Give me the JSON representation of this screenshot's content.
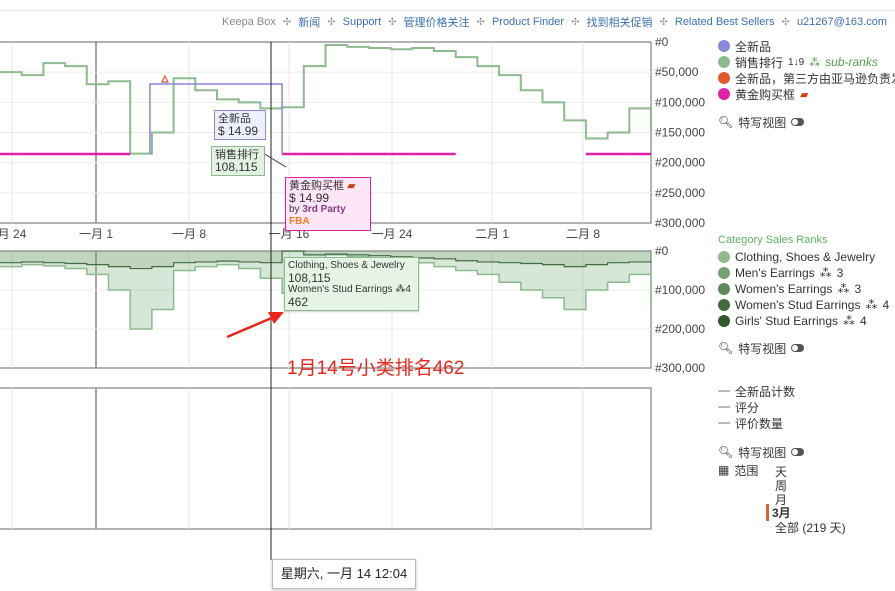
{
  "nav": {
    "items": [
      "Keepa Box",
      "新闻",
      "Support",
      "管理价格关注",
      "Product Finder",
      "找到相关促销",
      "Related Best Sellers",
      "u21267@163.com"
    ],
    "separator": "✣"
  },
  "legend_top": {
    "items": [
      {
        "label": "全新品",
        "color": "#8888dd"
      },
      {
        "label": "销售排行",
        "color": "#8dbb8d",
        "sort_icon": "1↓9",
        "sub_label": "sub-ranks"
      },
      {
        "label": "全新品，第三方由亚马逊负责发",
        "color": "#e05a2b"
      },
      {
        "label": "黄金购买框",
        "color": "#e020a8"
      }
    ],
    "close_view": "特写视图"
  },
  "legend_mid": {
    "title": "Category Sales Ranks",
    "items": [
      {
        "label": "Clothing, Shoes & Jewelry",
        "color": "#8dbb8d",
        "level": ""
      },
      {
        "label": "Men's Earrings",
        "color": "#74a374",
        "level": "3"
      },
      {
        "label": "Women's Earrings",
        "color": "#5a8a5a",
        "level": "3"
      },
      {
        "label": "Women's Stud Earrings",
        "color": "#3f6d3f",
        "level": "4"
      },
      {
        "label": "Girls' Stud Earrings",
        "color": "#2e5a2e",
        "level": "4"
      }
    ],
    "close_view": "特写视图"
  },
  "legend_bottom": {
    "items": [
      "全新品计数",
      "评分",
      "评价数量"
    ],
    "close_view": "特写视图",
    "range_label": "范围",
    "range_options": [
      "天",
      "周",
      "月",
      "3月",
      "全部 (219 天)"
    ],
    "range_selected": "3月"
  },
  "tooltips": {
    "new": {
      "title": "全新品",
      "value": "$ 14.99"
    },
    "rank": {
      "title": "销售排行",
      "value": "108,115"
    },
    "buybox": {
      "title": "黄金购买框",
      "value": "$ 14.99",
      "seller_prefix": "by",
      "seller": "3rd Party",
      "fba": "FBA"
    },
    "category": {
      "cat": "Clothing, Shoes & Jewelry",
      "cat_value": "108,115",
      "sub": "Women's Stud Earrings",
      "sub_level": "4",
      "sub_value": "462"
    }
  },
  "annotation": "1月14号小类排名462",
  "hover_date": "星期六, 一月 14 12:04",
  "chart_data": [
    {
      "type": "line",
      "x_ticks": [
        "月 24",
        "一月 1",
        "一月 8",
        "一月 16",
        "一月 24",
        "二月 1",
        "二月 8"
      ],
      "y_ticks": [
        "#0",
        "#50,000",
        "#100,000",
        "#150,000",
        "#200,000",
        "#250,000",
        "#300,000"
      ],
      "ylim": [
        0,
        300000
      ],
      "series": [
        {
          "name": "销售排行",
          "color": "#8dbb8d",
          "values": [
            50000,
            55000,
            35000,
            40000,
            70000,
            65000,
            185000,
            150000,
            60000,
            80000,
            95000,
            100000,
            110000,
            108115,
            40000,
            5000,
            8000,
            10000,
            12000,
            10000,
            15000,
            25000,
            40000,
            55000,
            80000,
            100000,
            130000,
            160000,
            150000,
            110000,
            150000
          ]
        },
        {
          "name": "全新品",
          "color": "#8888dd",
          "values": [
            null,
            null,
            null,
            null,
            null,
            null,
            null,
            14.99,
            14.99,
            14.99,
            14.99,
            14.99,
            14.99,
            14.99,
            null,
            null,
            null,
            null,
            null,
            null,
            null,
            null,
            null,
            null,
            null,
            null,
            null,
            null,
            null,
            null,
            null
          ]
        },
        {
          "name": "黄金购买框",
          "color": "#e020a8",
          "values": [
            14.99,
            14.99,
            14.99,
            14.99,
            14.99,
            14.99,
            14.99,
            null,
            null,
            null,
            null,
            null,
            null,
            14.99,
            14.99,
            14.99,
            14.99,
            14.99,
            14.99,
            14.99,
            14.99,
            14.99,
            null,
            null,
            null,
            null,
            null,
            14.99,
            14.99,
            14.99,
            14.99
          ]
        }
      ]
    },
    {
      "type": "area",
      "y_ticks": [
        "#0",
        "#100,000",
        "#200,000",
        "#300,000"
      ],
      "ylim": [
        0,
        300000
      ],
      "series": [
        {
          "name": "Clothing, Shoes & Jewelry",
          "color": "#8dbb8d",
          "values": [
            40000,
            35000,
            38000,
            45000,
            60000,
            100000,
            200000,
            150000,
            50000,
            40000,
            35000,
            45000,
            70000,
            108115,
            20000,
            10000,
            15000,
            20000,
            25000,
            30000,
            40000,
            50000,
            60000,
            80000,
            100000,
            120000,
            150000,
            100000,
            80000,
            60000,
            150000
          ]
        },
        {
          "name": "Women's Stud Earrings",
          "color": "#3f6d3f",
          "values": [
            30000,
            28000,
            30000,
            32000,
            35000,
            40000,
            45000,
            40000,
            30000,
            28000,
            26000,
            28000,
            30000,
            462,
            10000,
            8000,
            10000,
            12000,
            15000,
            18000,
            20000,
            25000,
            28000,
            30000,
            32000,
            35000,
            40000,
            35000,
            30000,
            28000,
            30000
          ]
        }
      ]
    }
  ]
}
